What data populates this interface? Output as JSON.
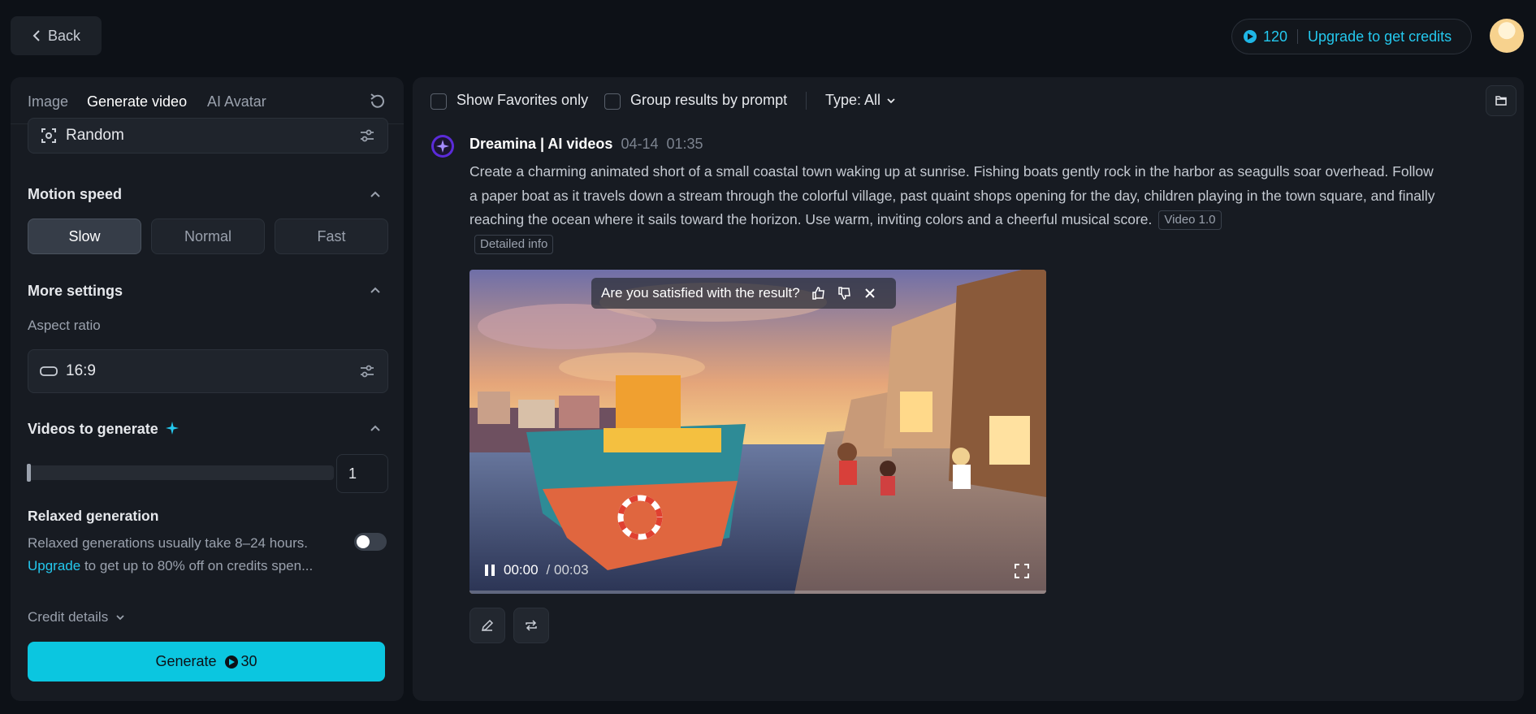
{
  "header": {
    "back_label": "Back",
    "credits": "120",
    "upgrade_label": "Upgrade to get credits"
  },
  "left": {
    "tabs": [
      "Image",
      "Generate video",
      "AI Avatar"
    ],
    "camera_value": "Random",
    "motion_speed": {
      "title": "Motion speed",
      "options": [
        "Slow",
        "Normal",
        "Fast"
      ],
      "selected": "Slow"
    },
    "more_settings": {
      "title": "More settings",
      "aspect_label": "Aspect ratio",
      "aspect_value": "16:9"
    },
    "videos_to_generate": {
      "title": "Videos to generate",
      "value": "1"
    },
    "relaxed": {
      "title": "Relaxed generation",
      "line1": "Relaxed generations usually take 8–24 hours.",
      "upgrade_link": "Upgrade",
      "line2": " to get up to 80% off on credits spen...",
      "enabled": false
    },
    "credit_details": "Credit details",
    "generate": {
      "label": "Generate",
      "cost": "30"
    }
  },
  "right": {
    "filters": {
      "favorites": "Show Favorites only",
      "group": "Group results by prompt",
      "type": "Type: All"
    },
    "result": {
      "author": "Dreamina | AI videos",
      "date": "04-14",
      "time": "01:35",
      "prompt": "Create a charming animated short of a small coastal town waking up at sunrise. Fishing boats gently rock in the harbor as seagulls soar overhead. Follow a paper boat as it travels down a stream through the colorful village, past quaint shops opening for the day, children playing in the town square, and finally reaching the ocean where it sails toward the horizon. Use warm, inviting colors and a cheerful musical score.",
      "model_tag": "Video 1.0",
      "detail_tag": "Detailed info",
      "feedback_question": "Are you satisfied with the result?",
      "video": {
        "current": "00:00",
        "total": "/ 00:03"
      }
    }
  },
  "colors": {
    "accent": "#0bc6e0",
    "background": "#0d1117",
    "panel": "#171b22"
  }
}
